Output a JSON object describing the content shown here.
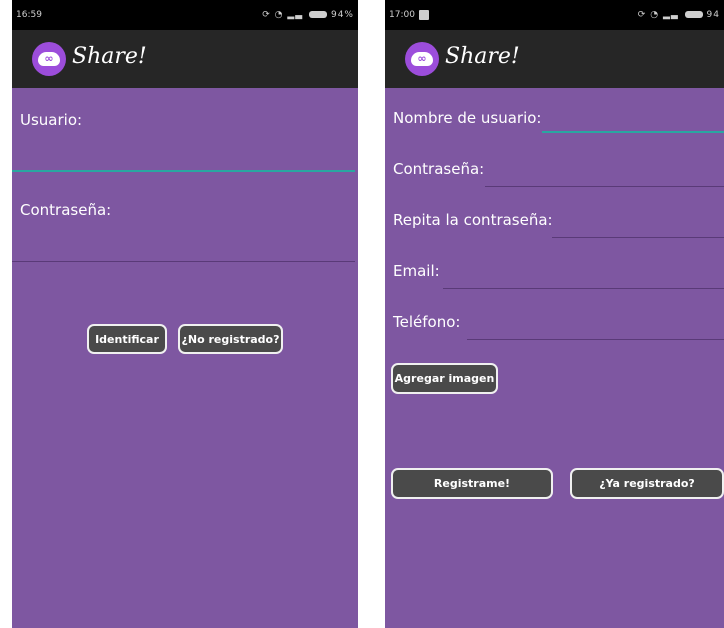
{
  "login_screen": {
    "status_time": "16:59",
    "status_battery": "94%",
    "app_title": "Share!",
    "username_label": "Usuario:",
    "password_label": "Contraseña:",
    "login_button": "Identificar",
    "not_registered_button": "¿No registrado?"
  },
  "register_screen": {
    "status_time": "17:00",
    "status_battery": "94",
    "app_title": "Share!",
    "username_label": "Nombre de usuario:",
    "password_label": "Contraseña:",
    "repeat_password_label": "Repita la contraseña:",
    "email_label": "Email:",
    "phone_label": "Teléfono:",
    "add_image_button": "Agregar imagen",
    "register_button": "Registrame!",
    "already_registered_button": "¿Ya registrado?"
  },
  "colors": {
    "background": "#7e57a1",
    "appbar": "#262626",
    "logo": "#9c4ddb",
    "focus_underline": "#2aa6a1",
    "button": "#4a4a4a"
  },
  "icons": [
    "share-logo-icon",
    "notification-icon",
    "signal-icon",
    "wifi-icon",
    "battery-icon"
  ]
}
